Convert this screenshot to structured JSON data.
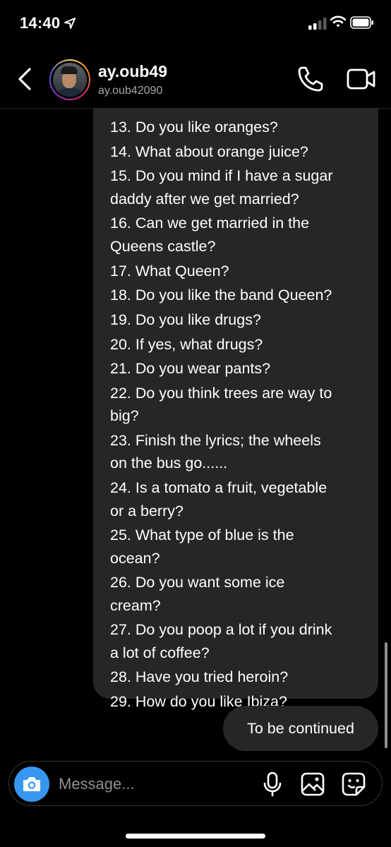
{
  "status_bar": {
    "time": "14:40",
    "icons": [
      "location-arrow-icon",
      "cellular-signal-icon",
      "wifi-icon",
      "battery-icon"
    ]
  },
  "header": {
    "contact_name": "ay.oub49",
    "contact_handle": "ay.oub42090",
    "icons": [
      "back-chevron-icon",
      "avatar",
      "phone-icon",
      "video-camera-icon"
    ]
  },
  "conversation": {
    "received_lines": [
      "13. Do you like oranges?",
      "14. What about orange juice?",
      "15. Do you mind if I have a sugar",
      "daddy after we get married?",
      "16. Can we get married in the",
      "Queens castle?",
      "17. What Queen?",
      "18. Do you like the band Queen?",
      "19. Do you like drugs?",
      "20. If yes, what drugs?",
      "21. Do you wear pants?",
      "22. Do you think trees are way to",
      "big?",
      "23. Finish the lyrics; the wheels",
      "on the bus go......",
      "24. Is a tomato a fruit, vegetable",
      "or a berry?",
      "25. What type of blue is the",
      "ocean?",
      "26. Do you want some ice",
      "cream?",
      "27. Do you poop a lot if you drink",
      "a lot of coffee?",
      "28. Have you tried heroin?",
      "29. How do you like Ibiza?"
    ],
    "sent_message": "To be continued"
  },
  "composer": {
    "placeholder": "Message...",
    "icons": [
      "camera-icon",
      "microphone-icon",
      "gallery-icon",
      "sticker-icon"
    ]
  },
  "colors": {
    "background": "#000000",
    "bubble": "#262626",
    "camera_button": "#3797f0",
    "secondary_text": "#a8a8a8"
  }
}
